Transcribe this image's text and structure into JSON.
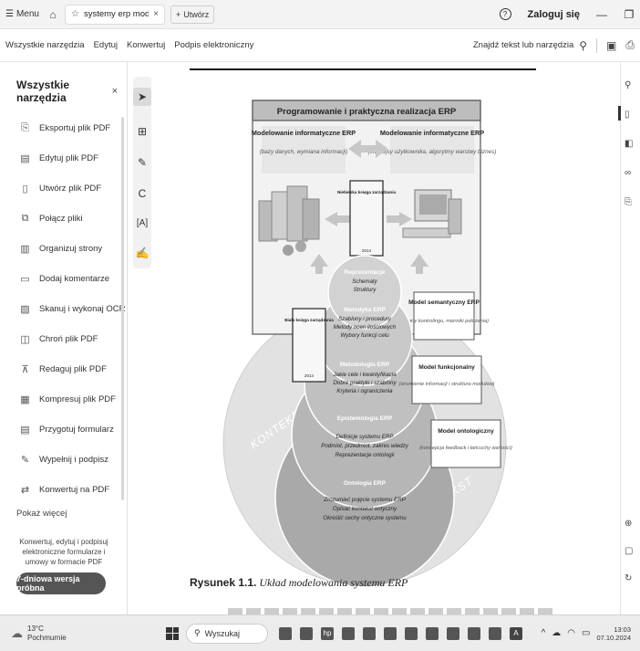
{
  "titlebar": {
    "menu_label": "Menu",
    "tab_label": "systemy erp modelow...",
    "new_tab_label": "Utwórz",
    "login_label": "Zaloguj się"
  },
  "toolbar": {
    "items": [
      "Wszystkie narzędzia",
      "Edytuj",
      "Konwertuj",
      "Podpis elektroniczny"
    ],
    "search_tools_label": "Znajdź tekst lub narzędzia"
  },
  "left_panel": {
    "title": "Wszystkie narzędzia",
    "tools": [
      {
        "label": "Eksportuj plik PDF",
        "icon": "export-pdf-icon"
      },
      {
        "label": "Edytuj plik PDF",
        "icon": "edit-pdf-icon"
      },
      {
        "label": "Utwórz plik PDF",
        "icon": "create-pdf-icon"
      },
      {
        "label": "Połącz pliki",
        "icon": "combine-files-icon"
      },
      {
        "label": "Organizuj strony",
        "icon": "organize-pages-icon"
      },
      {
        "label": "Dodaj komentarze",
        "icon": "comment-icon"
      },
      {
        "label": "Skanuj i wykonaj OCR",
        "icon": "scan-ocr-icon"
      },
      {
        "label": "Chroń plik PDF",
        "icon": "protect-pdf-icon"
      },
      {
        "label": "Redaguj plik PDF",
        "icon": "redact-pdf-icon"
      },
      {
        "label": "Kompresuj plik PDF",
        "icon": "compress-pdf-icon"
      },
      {
        "label": "Przygotuj formularz",
        "icon": "prepare-form-icon"
      },
      {
        "label": "Wypełnij i podpisz",
        "icon": "fill-sign-icon"
      },
      {
        "label": "Konwertuj na PDF",
        "icon": "convert-pdf-icon"
      }
    ],
    "more_label": "Pokaż więcej",
    "promo_text": "Konwertuj, edytuj i podpisuj elektroniczne formularze i umowy w formacie PDF",
    "trial_button": "7-dniowa wersja próbna"
  },
  "figure": {
    "header": "Programowanie i praktyczna realizacja ERP",
    "box_left": {
      "title": "Modelowanie informatyczne ERP",
      "subtitle": "(bazy danych, wymiana informacji)"
    },
    "box_right": {
      "title": "Modelowanie informatyczne ERP",
      "subtitle": "(interfejsy użytkownika, algorytmy warstwy biznes)"
    },
    "book_top": {
      "title": "Niebieska księga zarządzania",
      "year": "2014"
    },
    "book_left": {
      "title": "Biała księga zarządzania",
      "year": "2014"
    },
    "layers": [
      {
        "title": "Reprezentacje",
        "lines": [
          "Schematy",
          "Struktury"
        ]
      },
      {
        "title": "Metodyka ERP",
        "lines": [
          "Szablony i procedury",
          "Metody ocen ilościowych",
          "Wybory funkcji celu"
        ]
      },
      {
        "title": "Metodologia ERP",
        "lines": [
          "Jakie cele i kwantyfikacja",
          "Dobre praktyki i szablony",
          "Kryteria i ograniczenia"
        ]
      },
      {
        "title": "Epistemologia ERP",
        "lines": [
          "Definicje systemu ERP",
          "Podmiot, przedmiot, zakres wiedzy",
          "Reprezentacje ontologii"
        ]
      },
      {
        "title": "Ontologia ERP",
        "lines": [
          "Zrozumieć pojęcie systemu ERP",
          "Opisać kontekst ontyczny",
          "Określić cechy ontyczne systemu"
        ]
      }
    ],
    "models": [
      {
        "title": "Model semantyczny ERP",
        "subtitle": "(raporty kontrolingu, mierniki położenia)"
      },
      {
        "title": "Model funkcjonalny",
        "subtitle": "(strumienie informacji i struktura modułów)"
      },
      {
        "title": "Model ontologiczny",
        "subtitle": "(koncepcja feedback i łańcuchy wartości)"
      }
    ],
    "context_label": "KONTEKST",
    "caption_number": "Rysunek 1.1.",
    "caption_text": "Układ modelowania systemu ERP"
  },
  "taskbar": {
    "temperature": "13°C",
    "weather": "Pochmurnie",
    "search_label": "Wyszukaj",
    "time": "13:03",
    "date": "07.10.2024"
  }
}
